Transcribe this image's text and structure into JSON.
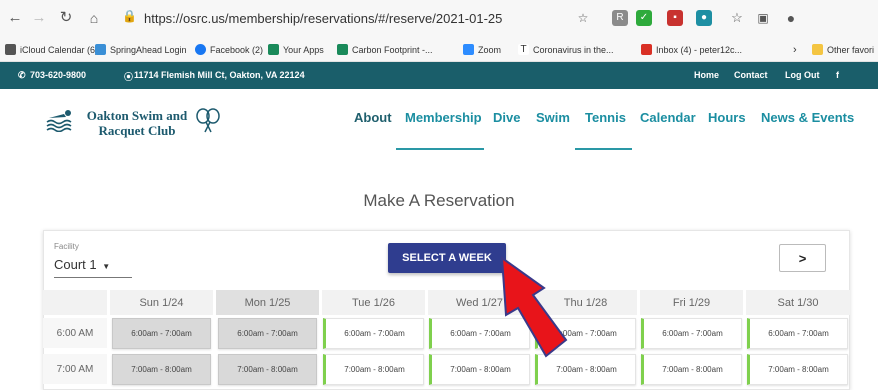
{
  "browser": {
    "url": "https://osrc.us/membership/reservations/#/reserve/2021-01-25",
    "bookmarks": [
      "iCloud Calendar (6)",
      "SpringAhead Login",
      "Facebook (2)",
      "Your Apps",
      "Carbon Footprint -...",
      "Zoom",
      "Coronavirus in the...",
      "Inbox (4) - peter12c...",
      "Other favori"
    ]
  },
  "topbar": {
    "phone": "703-620-9800",
    "address": "11714 Flemish Mill Ct, Oakton, VA 22124",
    "links": [
      "Home",
      "Contact",
      "Log Out",
      "f"
    ]
  },
  "header": {
    "logo_line1": "Oakton Swim and",
    "logo_line2": "Racquet Club",
    "nav": [
      "About",
      "Membership",
      "Dive",
      "Swim",
      "Tennis",
      "Calendar",
      "Hours",
      "News & Events"
    ]
  },
  "main": {
    "title": "Make A Reservation",
    "facility_label": "Facility",
    "facility_value": "Court 1",
    "select_week": "SELECT A WEEK",
    "next_symbol": ">",
    "days": [
      "Sun 1/24",
      "Mon 1/25",
      "Tue 1/26",
      "Wed 1/27",
      "Thu 1/28",
      "Fri 1/29",
      "Sat 1/30"
    ],
    "times": [
      "6:00 AM",
      "7:00 AM"
    ],
    "slots": [
      "6:00am - 7:00am",
      "7:00am - 8:00am"
    ]
  },
  "colors": {
    "brand_dark": "#1a5e6a",
    "link": "#1b8ea1",
    "button": "#2f3d8f",
    "available": "#7fd04d",
    "arrow": "#e8141a"
  }
}
